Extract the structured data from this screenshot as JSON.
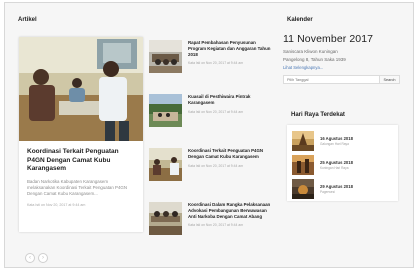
{
  "articles_section": {
    "title": "Artikel"
  },
  "featured": {
    "title": "Koordinasi Terkait Penguatan P4GN Dengan Camat Kubu Karangasem",
    "excerpt": "Badan Narkotika Kabupaten Karangasem melaksanakan Koordinasi Terkait Penguatan P4GN Dengan Camat Kubu Karangasem...",
    "meta": "Kata Isti on Nov 20, 2017 at 9:44 am"
  },
  "list": [
    {
      "title": "Rapat Pembahasan Penyusunan Program Kegiatan dan Anggaran Tahun 2018",
      "meta": "Kata Isti on Nov 20, 2017 at 9:44 am"
    },
    {
      "title": "Kuasail di Pesthiwaira Pintrak Karangasem",
      "meta": "Kata Isti on Nov 20, 2017 at 9:44 am"
    },
    {
      "title": "Koordinasi Terkait Penguatan P4GN Dengan Camat Kubu Karangasem",
      "meta": "Kata Isti on Nov 20, 2017 at 9:44 am"
    },
    {
      "title": "Koordinasi Dalam Rangka Pelaksanaan Advokasi Pembangunan Berwawasan Anti Narkoba Dengan Camat Abang",
      "meta": "Kata Isti on Nov 20, 2017 at 9:44 am"
    }
  ],
  "calendar": {
    "title": "Kalender",
    "date": "11 November 2017",
    "line1": "Saniscara Kliwon Kuningan",
    "line2": "Pangelong 8, Tahun Saka 1939",
    "link": "Lihat Selengkapnya...",
    "search_placeholder": "Pilih Tanggal",
    "search_button": "Search"
  },
  "holidays": {
    "title": "Hari Raya Terdekat",
    "items": [
      {
        "date": "16 Agustus 2018",
        "sub": "Galungan Hari Raya"
      },
      {
        "date": "25 Agustus 2018",
        "sub": "Kuningan Hari Raya"
      },
      {
        "date": "29 Agustus 2018",
        "sub": "Pagerwesi"
      }
    ]
  },
  "pager": {
    "prev": "‹",
    "next": "›"
  },
  "colors": {
    "link": "#4a78b5",
    "accent": "#222222"
  }
}
